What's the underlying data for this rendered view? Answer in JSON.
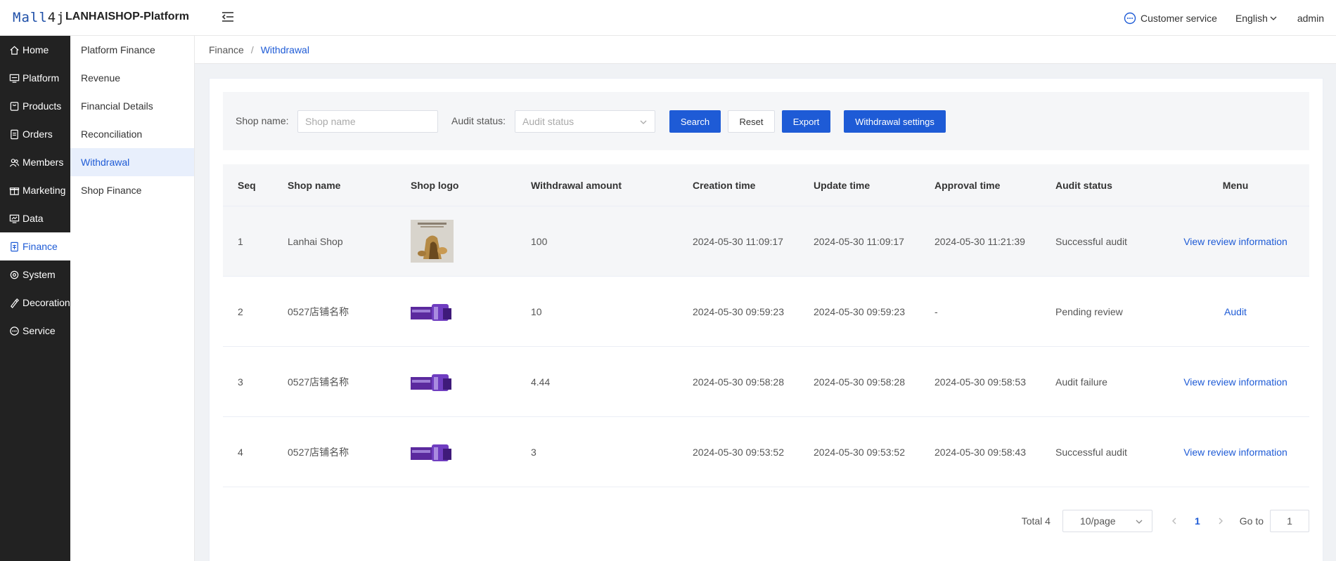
{
  "header": {
    "logo_text_a": "Mall",
    "logo_text_b": "4j",
    "app_name": "LANHAISHOP-Platform",
    "customer_service": "Customer service",
    "language": "English",
    "user": "admin",
    "icons": {
      "collapse": "menu-fold-icon",
      "customer_service": "chat-bubble-icon",
      "language": "chevron-down-icon"
    }
  },
  "main_nav": [
    {
      "label": "Home",
      "icon": "home-icon"
    },
    {
      "label": "Platform",
      "icon": "monitor-icon"
    },
    {
      "label": "Products",
      "icon": "bag-icon"
    },
    {
      "label": "Orders",
      "icon": "document-icon"
    },
    {
      "label": "Members",
      "icon": "users-icon"
    },
    {
      "label": "Marketing",
      "icon": "gift-icon"
    },
    {
      "label": "Data",
      "icon": "chart-icon"
    },
    {
      "label": "Finance",
      "icon": "finance-icon",
      "active": true
    },
    {
      "label": "System",
      "icon": "gear-icon"
    },
    {
      "label": "Decoration",
      "icon": "brush-icon"
    },
    {
      "label": "Service",
      "icon": "message-icon"
    }
  ],
  "sub_nav": [
    {
      "label": "Platform Finance"
    },
    {
      "label": "Revenue"
    },
    {
      "label": "Financial Details"
    },
    {
      "label": "Reconciliation"
    },
    {
      "label": "Withdrawal",
      "active": true
    },
    {
      "label": "Shop Finance"
    }
  ],
  "breadcrumb": {
    "parent": "Finance",
    "separator": "/",
    "current": "Withdrawal"
  },
  "filters": {
    "shop_name_label": "Shop name:",
    "shop_name_placeholder": "Shop name",
    "shop_name_value": "",
    "audit_status_label": "Audit status:",
    "audit_status_placeholder": "Audit status",
    "search_button": "Search",
    "reset_button": "Reset",
    "export_button": "Export",
    "settings_button": "Withdrawal settings"
  },
  "table": {
    "columns": [
      "Seq",
      "Shop name",
      "Shop logo",
      "Withdrawal amount",
      "Creation time",
      "Update time",
      "Approval time",
      "Audit status",
      "Menu"
    ],
    "rows": [
      {
        "seq": "1",
        "shop_name": "Lanhai Shop",
        "logo": "tea-product-photo",
        "amount": "100",
        "created": "2024-05-30 11:09:17",
        "updated": "2024-05-30 11:09:17",
        "approved": "2024-05-30 11:21:39",
        "status": "Successful audit",
        "action": "View review information"
      },
      {
        "seq": "2",
        "shop_name": "0527店铺名称",
        "logo": "purple-box-photo",
        "amount": "10",
        "created": "2024-05-30 09:59:23",
        "updated": "2024-05-30 09:59:23",
        "approved": "-",
        "status": "Pending review",
        "action": "Audit"
      },
      {
        "seq": "3",
        "shop_name": "0527店铺名称",
        "logo": "purple-box-photo",
        "amount": "4.44",
        "created": "2024-05-30 09:58:28",
        "updated": "2024-05-30 09:58:28",
        "approved": "2024-05-30 09:58:53",
        "status": "Audit failure",
        "action": "View review information"
      },
      {
        "seq": "4",
        "shop_name": "0527店铺名称",
        "logo": "purple-box-photo",
        "amount": "3",
        "created": "2024-05-30 09:53:52",
        "updated": "2024-05-30 09:53:52",
        "approved": "2024-05-30 09:58:43",
        "status": "Successful audit",
        "action": "View review information"
      }
    ]
  },
  "pagination": {
    "total": "Total 4",
    "page_size": "10/page",
    "current_page": "1",
    "goto_label": "Go to",
    "goto_value": "1"
  },
  "colors": {
    "primary": "#1e5bd6",
    "sidebar": "#222222",
    "active_sub_bg": "#e8effc"
  }
}
